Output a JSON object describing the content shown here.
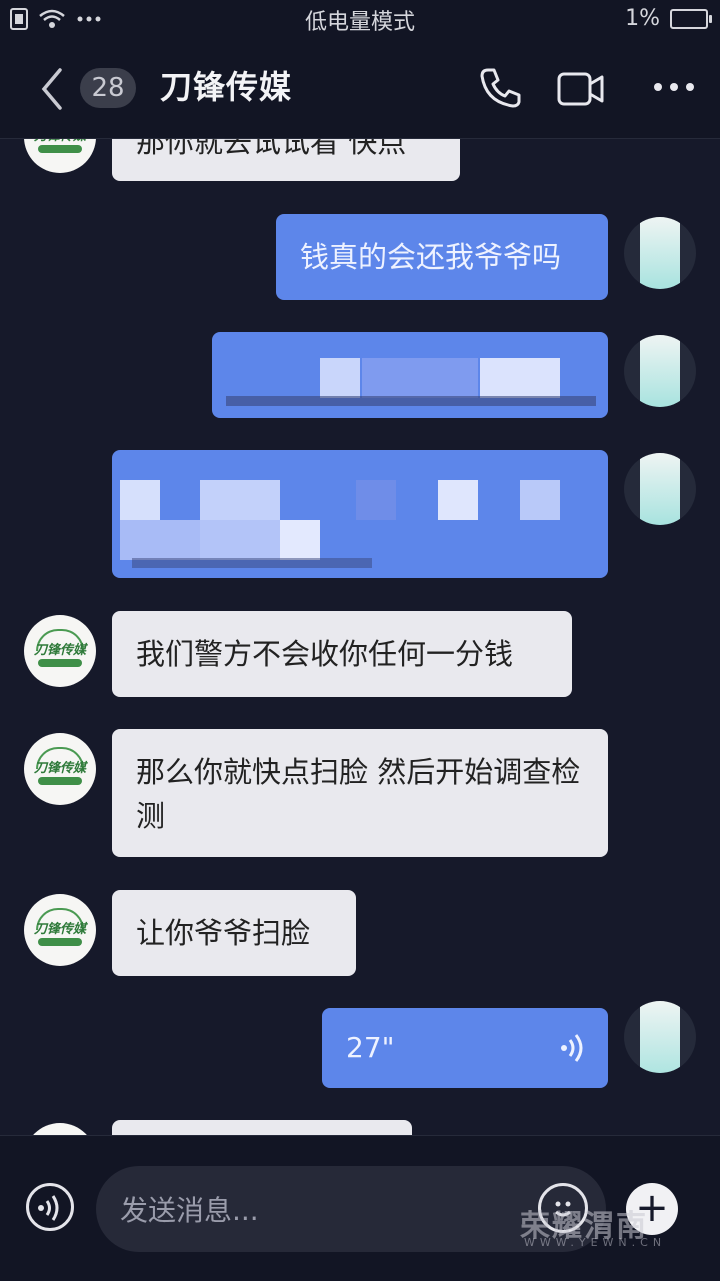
{
  "status_bar": {
    "mode": "低电量模式",
    "battery": "1%"
  },
  "header": {
    "back_label": "<",
    "unread_count": "28",
    "title": "刀锋传媒"
  },
  "messages": [
    {
      "from": "other",
      "text": "那你就去试试看 快点"
    },
    {
      "from": "me",
      "text": "钱真的会还我爷爷吗"
    },
    {
      "from": "me",
      "text": ""
    },
    {
      "from": "me",
      "text": ""
    },
    {
      "from": "other",
      "text": "我们警方不会收你任何一分钱"
    },
    {
      "from": "other",
      "text": "那么你就快点扫脸 然后开始调查检测"
    },
    {
      "from": "other",
      "text": "让你爷爷扫脸"
    },
    {
      "from": "me",
      "type": "voice",
      "duration": "27\""
    }
  ],
  "avatar_logo": "刀锋传媒",
  "input": {
    "placeholder": "发送消息..."
  },
  "watermark": {
    "brand": "荣耀渭南",
    "domain": "WWW.YEWN.CN"
  },
  "colors": {
    "outgoing_bubble": "#5d86ea",
    "incoming_bubble": "#e9e9ee",
    "background": "#16192a"
  }
}
